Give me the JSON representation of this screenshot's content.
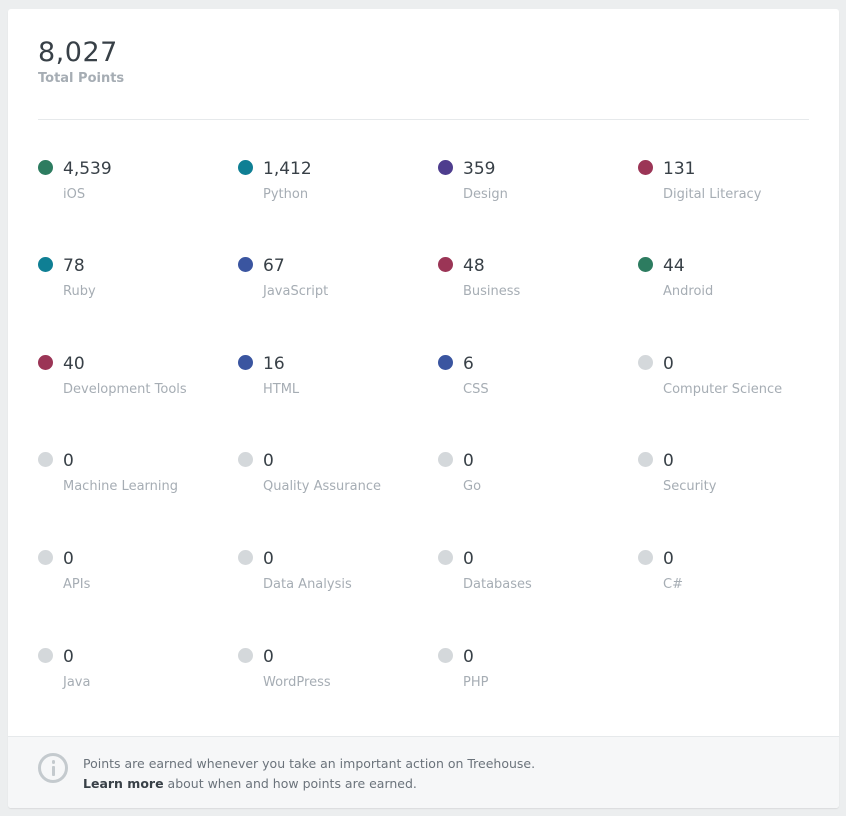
{
  "total": {
    "value": "8,027",
    "label": "Total Points"
  },
  "topics": [
    {
      "points": "4,539",
      "name": "iOS",
      "color": "#2d7c60"
    },
    {
      "points": "1,412",
      "name": "Python",
      "color": "#0f7f94"
    },
    {
      "points": "359",
      "name": "Design",
      "color": "#4e3d8e"
    },
    {
      "points": "131",
      "name": "Digital Literacy",
      "color": "#9b3556"
    },
    {
      "points": "78",
      "name": "Ruby",
      "color": "#0f7f94"
    },
    {
      "points": "67",
      "name": "JavaScript",
      "color": "#3a55a0"
    },
    {
      "points": "48",
      "name": "Business",
      "color": "#9b3556"
    },
    {
      "points": "44",
      "name": "Android",
      "color": "#2d7c60"
    },
    {
      "points": "40",
      "name": "Development Tools",
      "color": "#9b3556"
    },
    {
      "points": "16",
      "name": "HTML",
      "color": "#3a55a0"
    },
    {
      "points": "6",
      "name": "CSS",
      "color": "#3a55a0"
    },
    {
      "points": "0",
      "name": "Computer Science",
      "color": "#d4d8db"
    },
    {
      "points": "0",
      "name": "Machine Learning",
      "color": "#d4d8db"
    },
    {
      "points": "0",
      "name": "Quality Assurance",
      "color": "#d4d8db"
    },
    {
      "points": "0",
      "name": "Go",
      "color": "#d4d8db"
    },
    {
      "points": "0",
      "name": "Security",
      "color": "#d4d8db"
    },
    {
      "points": "0",
      "name": "APIs",
      "color": "#d4d8db"
    },
    {
      "points": "0",
      "name": "Data Analysis",
      "color": "#d4d8db"
    },
    {
      "points": "0",
      "name": "Databases",
      "color": "#d4d8db"
    },
    {
      "points": "0",
      "name": "C#",
      "color": "#d4d8db"
    },
    {
      "points": "0",
      "name": "Java",
      "color": "#d4d8db"
    },
    {
      "points": "0",
      "name": "WordPress",
      "color": "#d4d8db"
    },
    {
      "points": "0",
      "name": "PHP",
      "color": "#d4d8db"
    }
  ],
  "footer": {
    "info_icon": "info-icon",
    "line1": "Points are earned whenever you take an important action on Treehouse.",
    "learn_more": "Learn more",
    "line2_rest": " about when and how points are earned."
  }
}
